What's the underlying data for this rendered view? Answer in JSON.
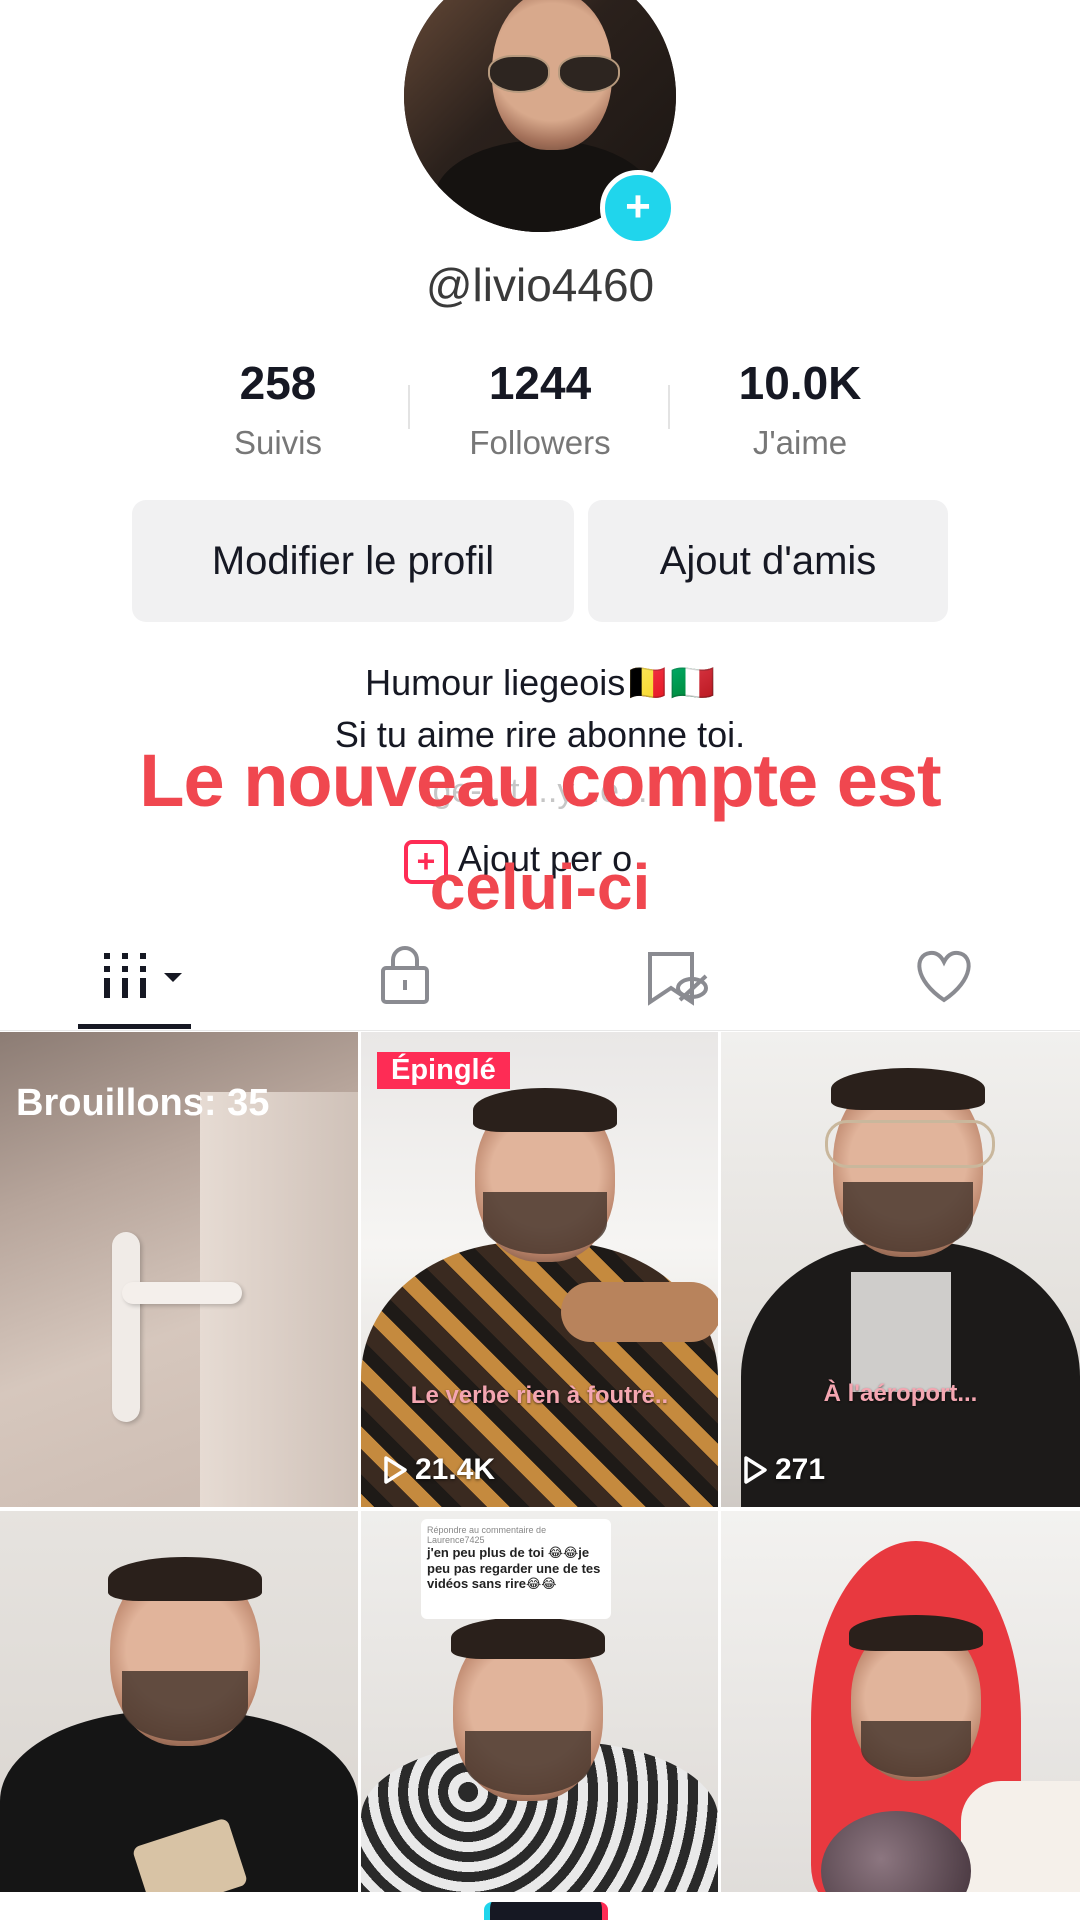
{
  "profile": {
    "username": "@livio4460",
    "stats": [
      {
        "value": "258",
        "label": "Suivis"
      },
      {
        "value": "1244",
        "label": "Followers"
      },
      {
        "value": "10.0K",
        "label": "J'aime"
      }
    ],
    "buttons": {
      "edit": "Modifier le profil",
      "add_friends": "Ajout d'amis"
    },
    "bio": {
      "line1": "Humour liegeois🇧🇪🇮🇹",
      "line2": "Si tu aime rire abonne toi.",
      "line3": "ge-...t ...y...e...",
      "add_bio": "Ajout per o"
    },
    "overlay": {
      "line1": "Le nouveau compte est",
      "line2": "celui-ci"
    }
  },
  "tabs": [
    {
      "name": "videos",
      "icon": "grid-icon"
    },
    {
      "name": "private",
      "icon": "lock-icon"
    },
    {
      "name": "saved",
      "icon": "bookmark-hidden-icon"
    },
    {
      "name": "liked",
      "icon": "heart-icon"
    }
  ],
  "grid": {
    "draft_label": "Brouillons: 35",
    "videos": [
      {
        "pinned": "Épinglé",
        "caption": "Le verbe rien à foutre..",
        "views": "21.4K"
      },
      {
        "caption": "À l'aéroport...",
        "views": "271"
      }
    ],
    "comment": {
      "header": "Répondre au commentaire de Laurence7425",
      "text": "j'en peu plus de toi 😂😂je peu pas regarder une de tes vidéos sans rire😂😂"
    }
  },
  "colors": {
    "accent": "#fe2c55",
    "overlay_text": "#f0474f",
    "badge": "#20d5ec"
  }
}
